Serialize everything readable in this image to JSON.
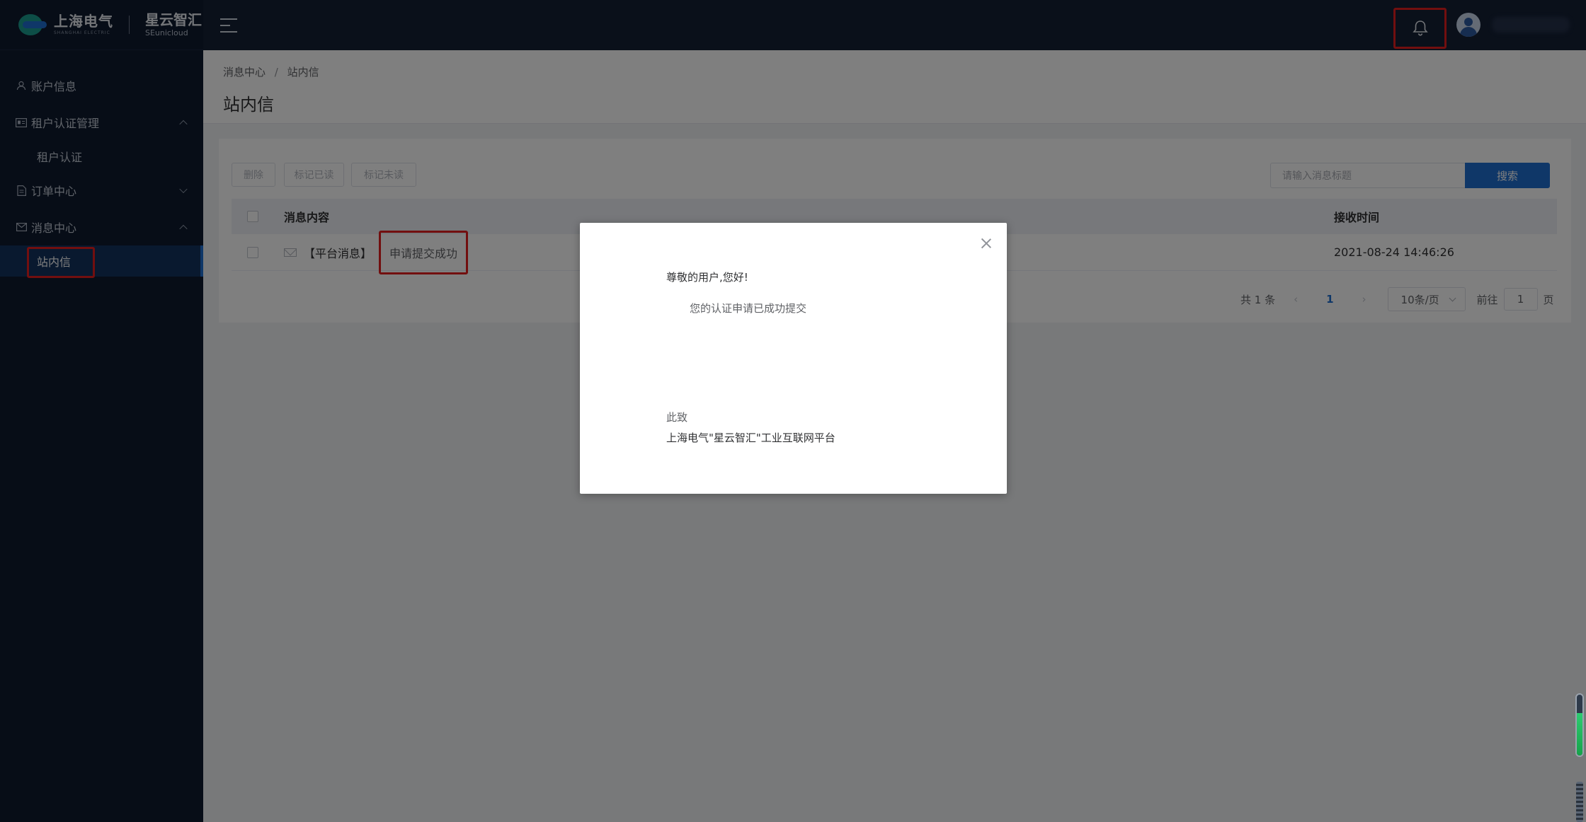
{
  "brand": {
    "company_name": "上海电气",
    "company_sub": "SHANGHAI ELECTRIC",
    "product_name": "星云智汇",
    "product_sub": "SEunicloud"
  },
  "sidebar": {
    "items": [
      {
        "label": "账户信息",
        "icon": "user-icon"
      },
      {
        "label": "租户认证管理",
        "icon": "id-card-icon",
        "expanded": true,
        "children": [
          {
            "label": "租户认证"
          }
        ]
      },
      {
        "label": "订单中心",
        "icon": "document-icon",
        "expanded": false
      },
      {
        "label": "消息中心",
        "icon": "mail-icon",
        "expanded": true,
        "children": [
          {
            "label": "站内信",
            "active": true
          }
        ]
      }
    ]
  },
  "header": {
    "menu_toggle_icon": "hamburger-icon",
    "notification_icon": "bell-icon",
    "avatar_icon": "avatar-icon"
  },
  "breadcrumb": [
    "消息中心",
    "站内信"
  ],
  "breadcrumb_separator": "/",
  "page_title": "站内信",
  "toolbar": {
    "delete_label": "删除",
    "mark_read_label": "标记已读",
    "mark_unread_label": "标记未读",
    "search_placeholder": "请输入消息标题",
    "search_label": "搜索"
  },
  "table": {
    "columns": [
      "消息内容",
      "接收时间"
    ],
    "rows": [
      {
        "tag": "【平台消息】",
        "title": "申请提交成功",
        "time": "2021-08-24 14:46:26"
      }
    ]
  },
  "pagination": {
    "total_text": "共 1 条",
    "current_page": "1",
    "page_size": "10条/页",
    "goto_label": "前往",
    "goto_value": "1",
    "page_unit": "页"
  },
  "modal": {
    "greeting": "尊敬的用户,您好!",
    "body": "您的认证申请已成功提交",
    "closing": "此致",
    "signature": "上海电气\"星云智汇\"工业互联网平台"
  },
  "colors": {
    "sidebar_bg": "#0f1a2e",
    "header_bg": "#142035",
    "accent": "#1f6fd0",
    "highlight": "#e51e1e"
  }
}
